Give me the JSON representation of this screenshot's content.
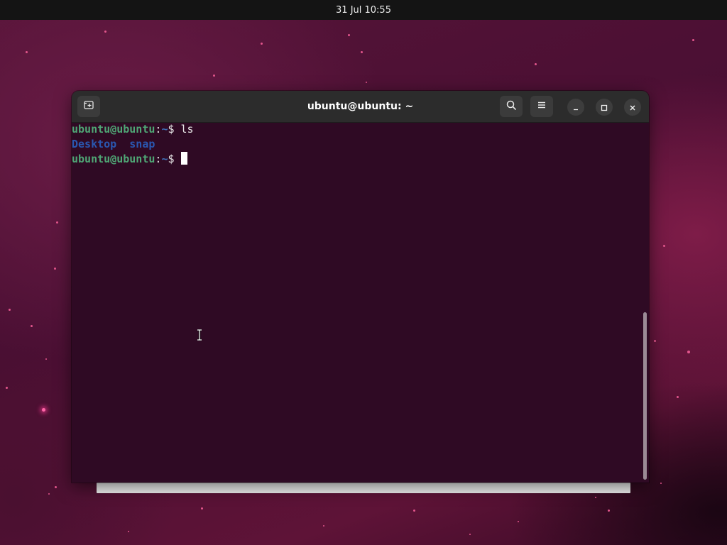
{
  "topbar": {
    "clock": "31 Jul  10:55"
  },
  "window": {
    "title": "ubuntu@ubuntu: ~",
    "new_tab_icon": "new-tab-icon",
    "search_icon": "search-icon",
    "menu_icon": "hamburger-menu-icon",
    "minimize_icon": "minimize-icon",
    "maximize_icon": "maximize-icon",
    "close_icon": "close-icon"
  },
  "terminal": {
    "lines": [
      {
        "user_host": "ubuntu@ubuntu",
        "sep": ":",
        "path": "~",
        "prompt": "$ ",
        "command": "ls"
      },
      {
        "output": [
          "Desktop",
          "snap"
        ]
      },
      {
        "user_host": "ubuntu@ubuntu",
        "sep": ":",
        "path": "~",
        "prompt": "$ ",
        "command": ""
      }
    ]
  },
  "colors": {
    "user_host": "#4fa675",
    "path": "#3f6fb8",
    "directory": "#2a57b0",
    "terminal_bg": "#2f0a24",
    "headerbar_bg": "#2c2c2c"
  }
}
